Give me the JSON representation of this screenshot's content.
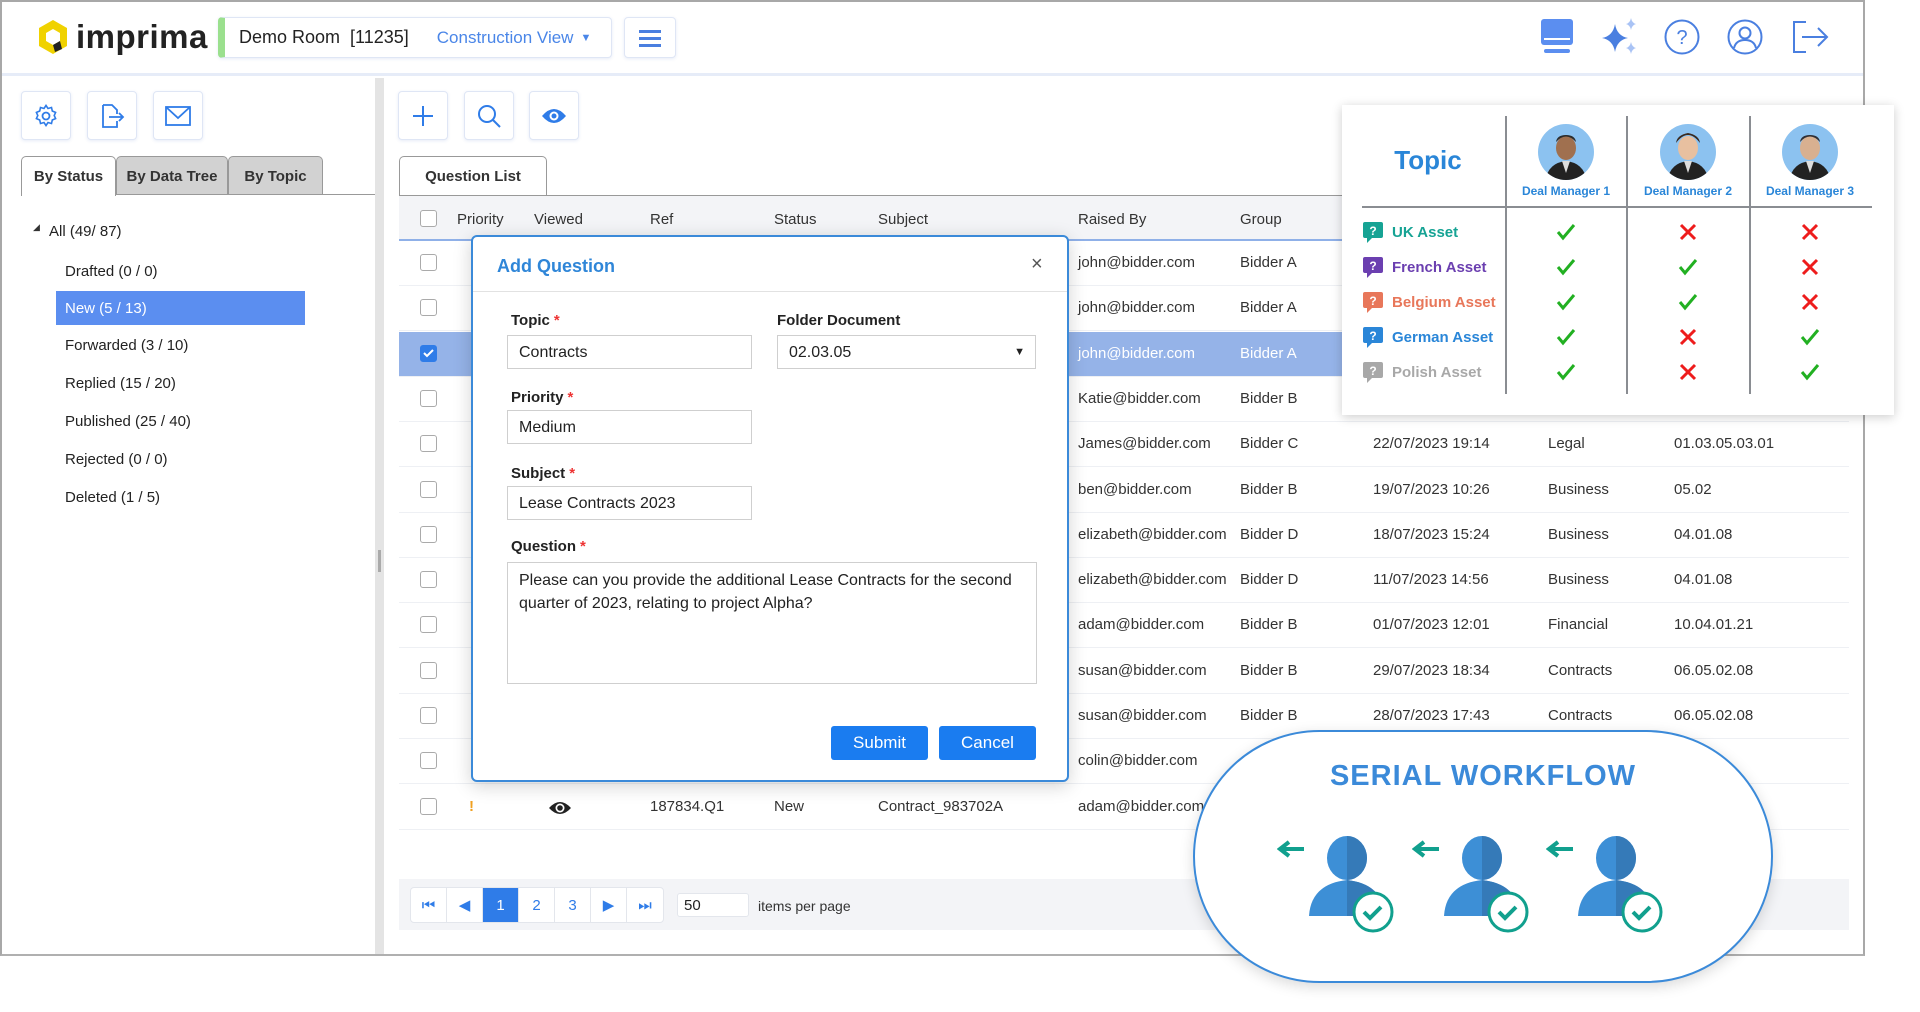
{
  "header": {
    "logo_text": "imprima",
    "room_name": "Demo Room",
    "room_id": "[11235]",
    "view_selector": "Construction View",
    "accent_color": "#2f7ce8",
    "right_icons": [
      "monitor-icon",
      "sparkle-icon",
      "help-icon",
      "user-icon",
      "logout-icon"
    ]
  },
  "sidebar": {
    "tool_icons": [
      "gear-icon",
      "export-file-icon",
      "mail-icon"
    ],
    "tabs": [
      {
        "label": "By Status",
        "active": true
      },
      {
        "label": "By Data Tree",
        "active": false
      },
      {
        "label": "By Topic",
        "active": false
      }
    ],
    "tree_root": "All (49/ 87)",
    "items": [
      {
        "label": "Drafted (0 / 0)",
        "selected": false
      },
      {
        "label": "New (5 / 13)",
        "selected": true
      },
      {
        "label": "Forwarded (3 / 10)",
        "selected": false
      },
      {
        "label": "Replied (15 / 20)",
        "selected": false
      },
      {
        "label": "Published (25 / 40)",
        "selected": false
      },
      {
        "label": "Rejected (0 / 0)",
        "selected": false
      },
      {
        "label": "Deleted (1 / 5)",
        "selected": false
      }
    ]
  },
  "main": {
    "tool_icons": [
      "plus-icon",
      "search-icon",
      "eye-icon"
    ],
    "tab": "Question List",
    "columns": [
      "Priority",
      "Viewed",
      "Ref",
      "Status",
      "Subject",
      "Raised By",
      "Group"
    ],
    "rows": [
      {
        "raised_by": "john@bidder.com",
        "group": "Bidder A",
        "checked": false
      },
      {
        "raised_by": "john@bidder.com",
        "group": "Bidder A",
        "checked": false
      },
      {
        "raised_by": "john@bidder.com",
        "group": "Bidder A",
        "checked": true
      },
      {
        "raised_by": "Katie@bidder.com",
        "group": "Bidder B",
        "checked": false
      },
      {
        "raised_by": "James@bidder.com",
        "group": "Bidder C",
        "date": "22/07/2023 19:14",
        "category": "Legal",
        "folder": "01.03.05.03.01",
        "checked": false
      },
      {
        "raised_by": "ben@bidder.com",
        "group": "Bidder B",
        "date": "19/07/2023 10:26",
        "category": "Business",
        "folder": "05.02",
        "checked": false
      },
      {
        "raised_by": "elizabeth@bidder.com",
        "group": "Bidder D",
        "date": "18/07/2023 15:24",
        "category": "Business",
        "folder": "04.01.08",
        "checked": false
      },
      {
        "raised_by": "elizabeth@bidder.com",
        "group": "Bidder D",
        "date": "11/07/2023 14:56",
        "category": "Business",
        "folder": "04.01.08",
        "checked": false
      },
      {
        "raised_by": "adam@bidder.com",
        "group": "Bidder B",
        "date": "01/07/2023 12:01",
        "category": "Financial",
        "folder": "10.04.01.21",
        "checked": false
      },
      {
        "raised_by": "susan@bidder.com",
        "group": "Bidder B",
        "date": "29/07/2023 18:34",
        "category": "Contracts",
        "folder": "06.05.02.08",
        "checked": false
      },
      {
        "raised_by": "susan@bidder.com",
        "group": "Bidder B",
        "date": "28/07/2023 17:43",
        "category": "Contracts",
        "folder": "06.05.02.08",
        "checked": false
      },
      {
        "raised_by": "colin@bidder.com",
        "checked": false
      },
      {
        "priority": "!",
        "viewed": "eye-icon",
        "ref": "187834.Q1",
        "status": "New",
        "subject": "Contract_983702A",
        "raised_by": "adam@bidder.com",
        "checked": false
      }
    ],
    "pagination": {
      "pages": [
        "1",
        "2",
        "3"
      ],
      "current": "1",
      "per_page": "50",
      "per_page_label": "items per page"
    }
  },
  "dialog": {
    "title": "Add Question",
    "topic_label": "Topic",
    "topic_value": "Contracts",
    "folder_label": "Folder Document",
    "folder_value": "02.03.05",
    "priority_label": "Priority",
    "priority_value": "Medium",
    "subject_label": "Subject",
    "subject_value": "Lease Contracts 2023",
    "question_label": "Question",
    "question_value": "Please can you provide the additional Lease Contracts for the second quarter of 2023, relating to project Alpha?",
    "required_mark": "*",
    "submit": "Submit",
    "cancel": "Cancel"
  },
  "topic_matrix": {
    "title": "Topic",
    "managers": [
      "Deal Manager 1",
      "Deal Manager 2",
      "Deal Manager 3"
    ],
    "topics": [
      {
        "label": "UK Asset",
        "color": "#16a394",
        "access": [
          true,
          false,
          false
        ]
      },
      {
        "label": "French Asset",
        "color": "#6b3fb0",
        "access": [
          true,
          true,
          false
        ]
      },
      {
        "label": "Belgium Asset",
        "color": "#e8775a",
        "access": [
          true,
          true,
          false
        ]
      },
      {
        "label": "German Asset",
        "color": "#2a86d8",
        "access": [
          true,
          false,
          true
        ]
      },
      {
        "label": "Polish Asset",
        "color": "#a8a8a8",
        "access": [
          true,
          false,
          true
        ]
      }
    ]
  },
  "workflow": {
    "title": "SERIAL WORKFLOW",
    "steps": 3
  }
}
